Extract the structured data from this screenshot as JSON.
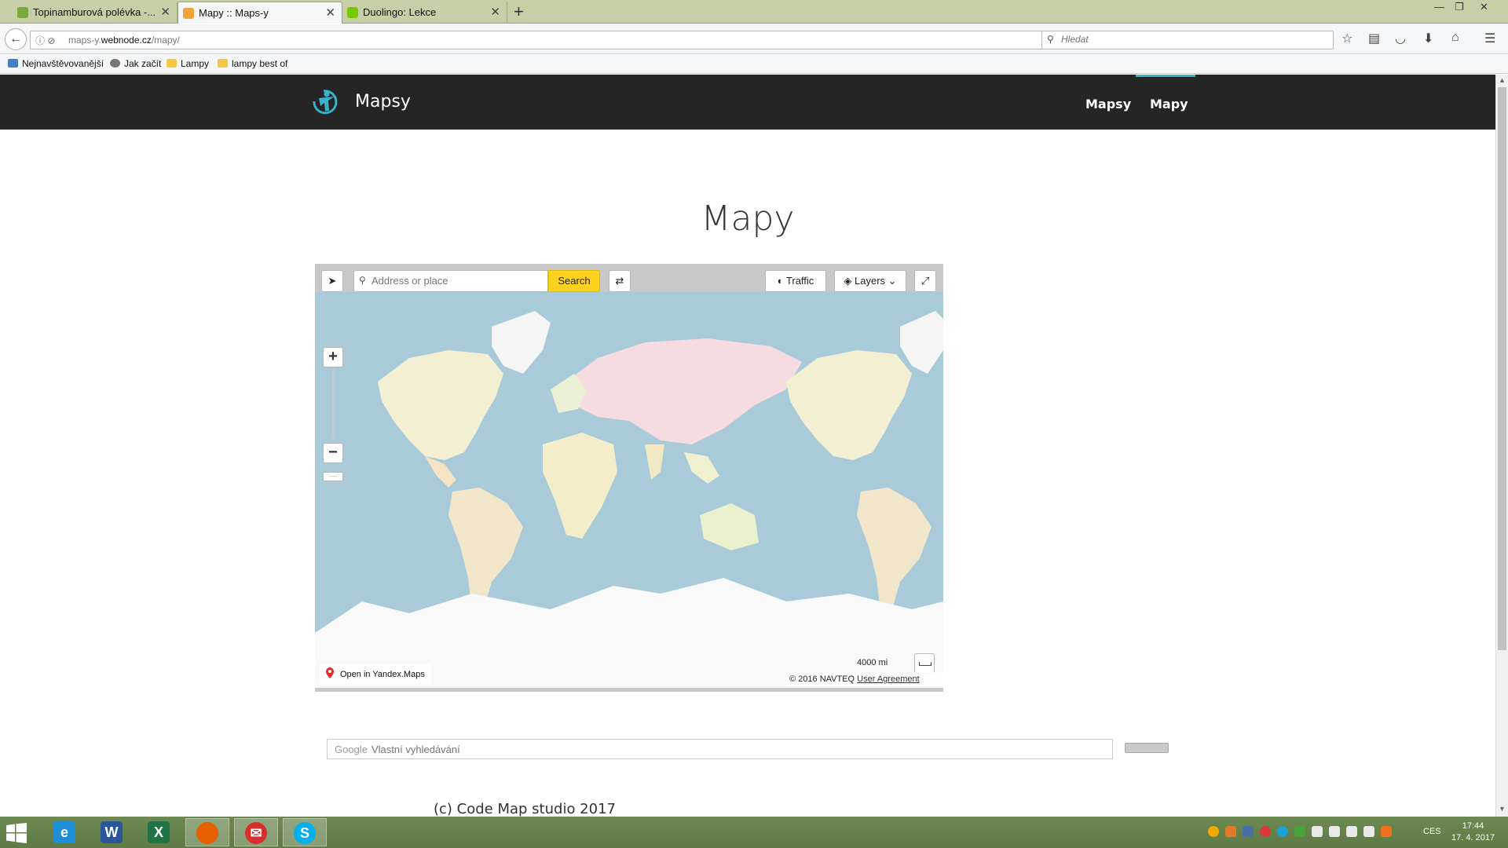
{
  "browser": {
    "tabs": [
      {
        "title": "Topinamburová polévka -...",
        "favicon_color": "#7aa83a"
      },
      {
        "title": "Mapy :: Maps-y",
        "favicon_color": "#f2a33a"
      },
      {
        "title": "Duolingo: Lekce",
        "favicon_color": "#78c800"
      }
    ],
    "new_tab_label": "+",
    "url_prefix": "maps-y.",
    "url_domain": "webnode.cz",
    "url_path": "/mapy/",
    "search_placeholder": "Hledat",
    "bookmarks": [
      {
        "label": "Nejnavštěvovanější",
        "icon_color": "#4a7ec2"
      },
      {
        "label": "Jak začít",
        "icon_color": "#777777"
      },
      {
        "label": "Lampy",
        "icon_color": "#f4c842"
      },
      {
        "label": "lampy best of",
        "icon_color": "#f4c842"
      }
    ]
  },
  "site": {
    "brand": "Mapsy",
    "nav": [
      {
        "label": "Mapsy"
      },
      {
        "label": "Mapy"
      }
    ],
    "page_title": "Mapy",
    "accent_color": "#3ab1c8"
  },
  "map": {
    "search_placeholder": "Address or place",
    "search_button": "Search",
    "traffic_label": "Traffic",
    "layers_label": "Layers",
    "zoom_in": "+",
    "zoom_out": "−",
    "open_link": "Open in Yandex.Maps",
    "scale_label": "4000 mi",
    "copyright": "© 2016 NAVTEQ",
    "agreement_link": "User Agreement"
  },
  "custom_search": {
    "brand": "Google",
    "placeholder": "Vlastní vyhledávání"
  },
  "footer": {
    "text": "(c) Code Map studio 2017"
  },
  "taskbar": {
    "language": "CES",
    "time": "17:44",
    "date": "17. 4. 2017",
    "apps": [
      {
        "name": "internet-explorer",
        "glyph": "e",
        "color": "#1e8fd6"
      },
      {
        "name": "word",
        "glyph": "W",
        "color": "#2b579a"
      },
      {
        "name": "excel",
        "glyph": "X",
        "color": "#217346"
      },
      {
        "name": "firefox",
        "glyph": "",
        "color": "#e66000"
      },
      {
        "name": "mail",
        "glyph": "✉",
        "color": "#d92e2e"
      },
      {
        "name": "skype",
        "glyph": "S",
        "color": "#00aff0"
      }
    ]
  }
}
